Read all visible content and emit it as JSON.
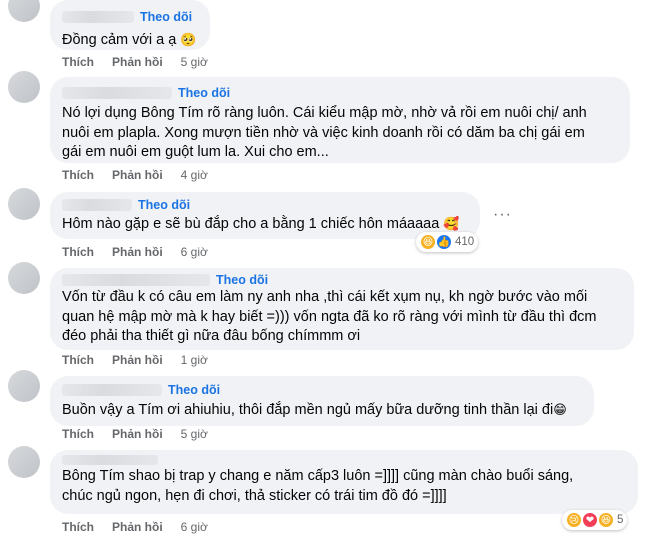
{
  "comments": [
    {
      "follow_label": "Theo dõi",
      "text": "Đồng cảm với a ạ",
      "text_emoji": "🥺",
      "like_label": "Thích",
      "reply_label": "Phản hồi",
      "time": "5 giờ"
    },
    {
      "follow_label": "Theo dõi",
      "text": "Nó lợi dụng Bông Tím rõ ràng luôn. Cái kiểu mập mờ, nhờ vả rồi em nuôi chị/ anh\nnuôi em plapla. Xong mượn tiền nhờ và việc kinh doanh rồi có dăm ba chị gái em\ngái em nuôi em guột lum la. Xui cho em...",
      "like_label": "Thích",
      "reply_label": "Phản hồi",
      "time": "4 giờ"
    },
    {
      "follow_label": "Theo dõi",
      "text": "Hôm nào gặp e sẽ bù đắp cho a bằng 1 chiếc hôn máaaaa",
      "text_emoji": "🥰",
      "like_label": "Thích",
      "reply_label": "Phản hồi",
      "time": "6 giờ",
      "reaction_count": "410",
      "reactions": [
        "haha-icon",
        "like-icon"
      ]
    },
    {
      "follow_label": "Theo dõi",
      "text": "Vốn từ đầu k có câu em làm ny anh nha ,thì cái kết xụm nụ, kh ngờ bước vào mối\nquan hệ mập mờ mà k hay biết =))) vốn ngta đã ko rõ ràng với mình từ đầu thì đcm\nđéo phải tha thiết gì nữa đâu bống chímmm ơi",
      "like_label": "Thích",
      "reply_label": "Phản hồi",
      "time": "1 giờ"
    },
    {
      "follow_label": "Theo dõi",
      "text": "Buồn vậy a Tím ơi ahiuhiu, thôi đắp mền ngủ mấy bữa dưỡng tinh thần lại đi",
      "text_emoji": "😁",
      "like_label": "Thích",
      "reply_label": "Phản hồi",
      "time": "5 giờ"
    },
    {
      "text": "Bông Tím shao bị trap y chang e năm cấp3 luôn =]]]] cũng màn chào buổi sáng,\nchúc ngủ ngon, hẹn đi chơi, thả sticker có trái tim đồ đó =]]]]",
      "like_label": "Thích",
      "reply_label": "Phản hồi",
      "time": "6 giờ",
      "reaction_count": "5",
      "reactions": [
        "sad-icon",
        "love-icon",
        "haha-icon"
      ]
    }
  ],
  "more_options_glyph": "···",
  "colors": {
    "accent": "#1b74e4",
    "bubble": "#f0f2f5",
    "meta": "#65676b"
  }
}
